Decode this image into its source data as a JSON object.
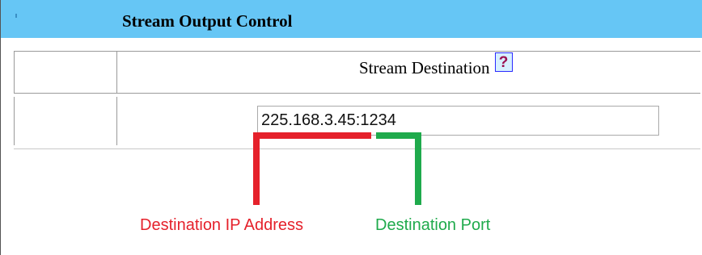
{
  "header": {
    "title": "Stream Output Control"
  },
  "stream": {
    "destination_label": "Stream Destination",
    "help_glyph": "?",
    "destination_value": "225.168.3.45:1234"
  },
  "annotations": {
    "ip_label": "Destination IP Address",
    "port_label": "Destination Port",
    "ip_color": "#e5212b",
    "port_color": "#1faa4c"
  },
  "colors": {
    "header_bg": "#66c6f5",
    "help_icon_border": "#2a2aff",
    "help_icon_glyph": "#9b1050"
  },
  "icons": {
    "help": "help-question-icon"
  }
}
